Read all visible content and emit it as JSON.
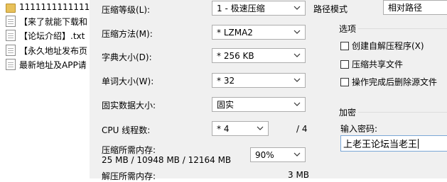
{
  "file_list": [
    {
      "label": "1111111111111111",
      "icon": "folder-icon"
    },
    {
      "label": "【来了就能下载和",
      "icon": "document-icon"
    },
    {
      "label": "【论坛介绍】.txt",
      "icon": "document-icon"
    },
    {
      "label": "【永久地址发布页",
      "icon": "document-icon"
    },
    {
      "label": "最新地址及APP请",
      "icon": "document-icon"
    }
  ],
  "options": {
    "compression_level": {
      "label": "压缩等级(L):",
      "value": "1 - 极速压缩"
    },
    "compression_method": {
      "label": "压缩方法(M):",
      "value": "* LZMA2"
    },
    "dictionary_size": {
      "label": "字典大小(D):",
      "value": "* 256 KB"
    },
    "word_size": {
      "label": "单词大小(W):",
      "value": "* 32"
    },
    "solid_block": {
      "label": "固实数据大小:",
      "value": "固实"
    },
    "cpu_threads": {
      "label": "CPU 线程数:",
      "value": "* 4",
      "max": "/ 4"
    },
    "memory_compress": {
      "label": "压缩所需内存:",
      "value": "25 MB / 10948 MB / 12164 MB",
      "percent": "90%"
    },
    "memory_decompress": {
      "label": "解压所需内存:",
      "value": "3 MB"
    }
  },
  "path_mode": {
    "label": "路径模式",
    "value": "相对路径"
  },
  "options_group": {
    "title": "选项",
    "items": [
      {
        "label": "创建自解压程序(X)",
        "checked": false
      },
      {
        "label": "压缩共享文件",
        "checked": false
      },
      {
        "label": "操作完成后删除源文件",
        "checked": false
      }
    ]
  },
  "encryption": {
    "title": "加密",
    "password_label": "输入密码:",
    "password_value": "上老王论坛当老王"
  }
}
